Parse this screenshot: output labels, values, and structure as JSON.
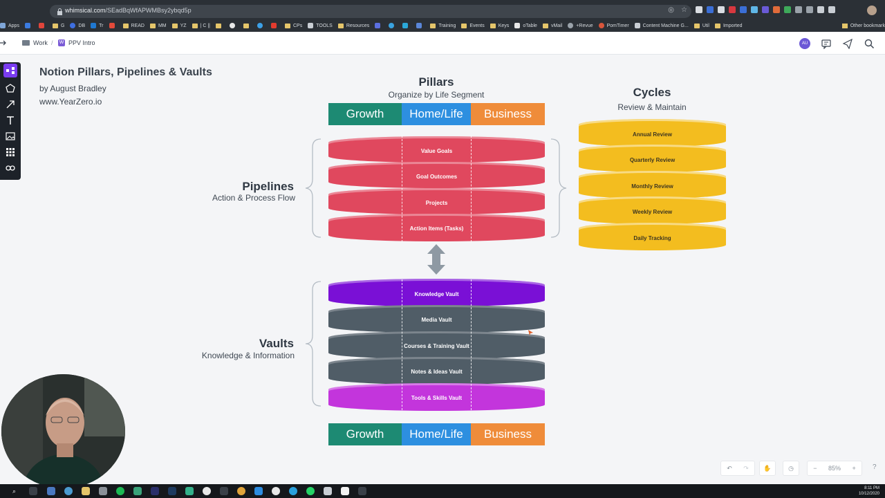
{
  "browser": {
    "url_host": "whimsical.com",
    "url_path": "/SEadBqWfAPWMBsy2ybqd5p",
    "bookmarks": [
      "Apps",
      "G",
      "DB",
      "Tr",
      "READ",
      "MM",
      "YZ",
      "| C ||",
      "TOOLS",
      "Resources",
      "Training",
      "Events",
      "Keys",
      "oTable",
      "vMail",
      "+Revue",
      "PomTimer",
      "Content Machine G...",
      "Util",
      "Imported"
    ],
    "bookmarks_right": "Other bookmark",
    "cps": "CPs"
  },
  "breadcrumb": {
    "folder": "Work",
    "doc": "PPV Intro"
  },
  "header": {
    "avatar": "AU"
  },
  "doc": {
    "title": "Notion Pillars, Pipelines & Vaults",
    "author": "by August Bradley",
    "site": "www.YearZero.io"
  },
  "pillars": {
    "title": "Pillars",
    "subtitle": "Organize by Life Segment"
  },
  "segments": {
    "growth": "Growth",
    "home": "Home/Life",
    "business": "Business"
  },
  "pipelines": {
    "title": "Pipelines",
    "subtitle": "Action & Process Flow",
    "items": [
      "Value Goals",
      "Goal Outcomes",
      "Projects",
      "Action Items (Tasks)"
    ]
  },
  "vaults": {
    "title": "Vaults",
    "subtitle": "Knowledge & Information",
    "items": [
      "Knowledge Vault",
      "Media Vault",
      "Courses & Training Vault",
      "Notes & Ideas Vault",
      "Tools & Skills Vault"
    ]
  },
  "cycles": {
    "title": "Cycles",
    "subtitle": "Review & Maintain",
    "items": [
      "Annual Review",
      "Quarterly Review",
      "Monthly Review",
      "Weekly Review",
      "Daily Tracking"
    ]
  },
  "zoom": {
    "level": "85%",
    "help": "?"
  },
  "taskbar": {
    "time": "8:11 PM",
    "date": "10/12/2020"
  },
  "colors": {
    "growth": "#1d8a73",
    "home": "#2d8fe0",
    "business": "#ef8c3a",
    "pipeline": "#e0485e",
    "cycle": "#f3bd1f"
  }
}
